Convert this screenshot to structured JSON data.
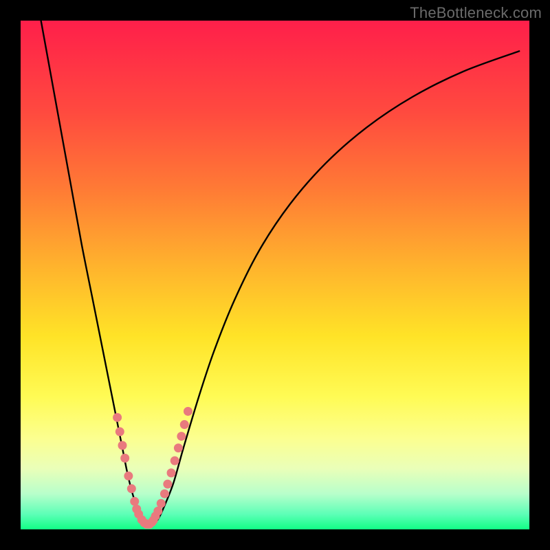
{
  "watermark": "TheBottleneck.com",
  "chart_data": {
    "type": "line",
    "title": "",
    "xlabel": "",
    "ylabel": "",
    "xlim": [
      0,
      100
    ],
    "ylim": [
      0,
      100
    ],
    "grid": false,
    "legend": false,
    "series": [
      {
        "name": "curve",
        "x": [
          4,
          6,
          8,
          10,
          12,
          14,
          16,
          18,
          20,
          21,
          22,
          23,
          24,
          25,
          26,
          27,
          28,
          30,
          32,
          35,
          38,
          42,
          47,
          53,
          60,
          68,
          77,
          87,
          98
        ],
        "values": [
          100,
          89,
          78,
          67,
          56,
          46,
          36,
          26,
          16,
          11,
          7,
          4,
          2,
          1,
          1,
          2,
          4,
          9,
          16,
          26,
          35,
          45,
          55,
          64,
          72,
          79,
          85,
          90,
          94
        ]
      }
    ],
    "markers": [
      {
        "name": "dots",
        "x": [
          19.0,
          19.5,
          20.0,
          20.5,
          21.2,
          21.8,
          22.4,
          22.8,
          23.2,
          23.8,
          24.3,
          24.8,
          25.3,
          25.8,
          26.1,
          26.5,
          27.0,
          27.6,
          28.3,
          28.9,
          29.6,
          30.3,
          31.0,
          31.6,
          32.2,
          32.9
        ],
        "values": [
          22.0,
          19.2,
          16.5,
          14.0,
          10.5,
          8.0,
          5.5,
          4.0,
          3.0,
          1.9,
          1.3,
          1.0,
          1.0,
          1.4,
          1.8,
          2.6,
          3.6,
          5.1,
          7.0,
          8.9,
          11.1,
          13.5,
          16.0,
          18.3,
          20.6,
          23.2
        ]
      }
    ]
  }
}
